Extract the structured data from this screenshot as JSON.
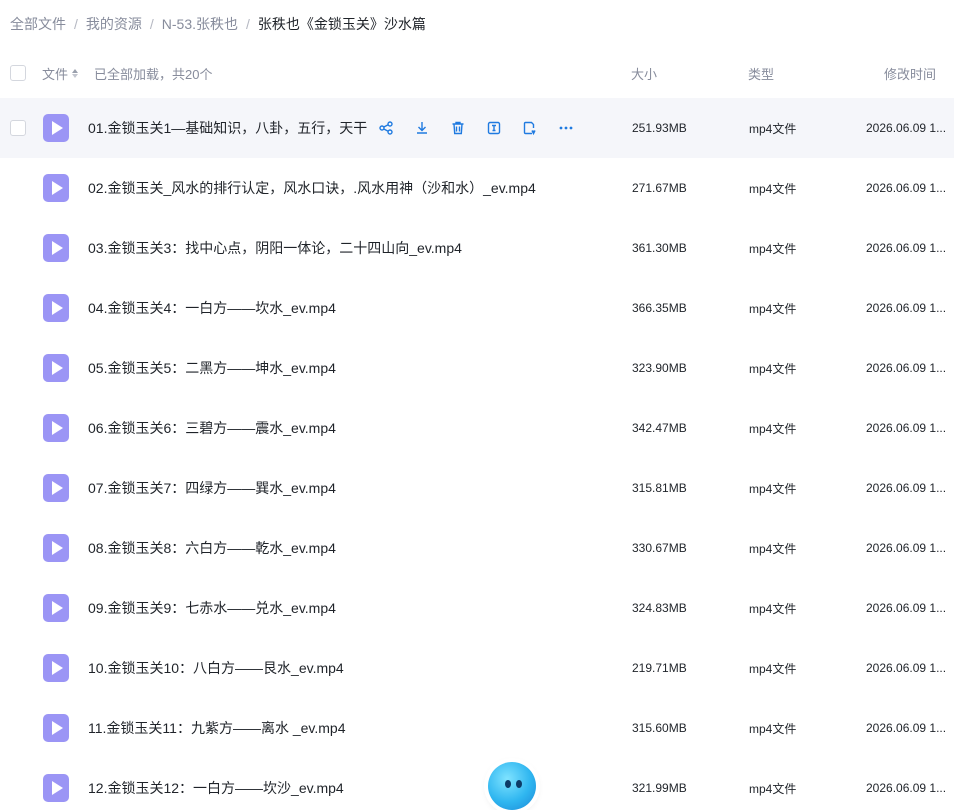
{
  "breadcrumb": [
    "全部文件",
    "我的资源",
    "N-53.张秩也",
    "张秩也《金锁玉关》沙水篇"
  ],
  "header": {
    "name_label": "文件",
    "loaded_text": "已全部加载，共20个",
    "size_label": "大小",
    "type_label": "类型",
    "time_label": "修改时间"
  },
  "files": [
    {
      "name": "01.金锁玉关1—基础知识，八卦，五行，天干",
      "size": "251.93MB",
      "type": "mp4文件",
      "time": "2026.06.09 1..."
    },
    {
      "name": "02.金锁玉关_风水的排行认定，风水口诀，.风水用神（沙和水）_ev.mp4",
      "size": "271.67MB",
      "type": "mp4文件",
      "time": "2026.06.09 1..."
    },
    {
      "name": "03.金锁玉关3：找中心点，阴阳一体论，二十四山向_ev.mp4",
      "size": "361.30MB",
      "type": "mp4文件",
      "time": "2026.06.09 1..."
    },
    {
      "name": "04.金锁玉关4：一白方——坎水_ev.mp4",
      "size": "366.35MB",
      "type": "mp4文件",
      "time": "2026.06.09 1..."
    },
    {
      "name": "05.金锁玉关5：二黑方——坤水_ev.mp4",
      "size": "323.90MB",
      "type": "mp4文件",
      "time": "2026.06.09 1..."
    },
    {
      "name": "06.金锁玉关6：三碧方——震水_ev.mp4",
      "size": "342.47MB",
      "type": "mp4文件",
      "time": "2026.06.09 1..."
    },
    {
      "name": "07.金锁玉关7：四绿方——巽水_ev.mp4",
      "size": "315.81MB",
      "type": "mp4文件",
      "time": "2026.06.09 1..."
    },
    {
      "name": "08.金锁玉关8：六白方——乾水_ev.mp4",
      "size": "330.67MB",
      "type": "mp4文件",
      "time": "2026.06.09 1..."
    },
    {
      "name": "09.金锁玉关9：七赤水——兑水_ev.mp4",
      "size": "324.83MB",
      "type": "mp4文件",
      "time": "2026.06.09 1..."
    },
    {
      "name": "10.金锁玉关10：八白方——艮水_ev.mp4",
      "size": "219.71MB",
      "type": "mp4文件",
      "time": "2026.06.09 1..."
    },
    {
      "name": "11.金锁玉关11：九紫方——离水 _ev.mp4",
      "size": "315.60MB",
      "type": "mp4文件",
      "time": "2026.06.09 1..."
    },
    {
      "name": "12.金锁玉关12：一白方——坎沙_ev.mp4",
      "size": "321.99MB",
      "type": "mp4文件",
      "time": "2026.06.09 1..."
    }
  ],
  "row_actions": [
    "share-icon",
    "download-icon",
    "delete-icon",
    "rename-icon",
    "copy-link-icon",
    "more-icon"
  ],
  "colors": {
    "accent": "#1f7ae0",
    "file_icon": "#9b95f5",
    "hover_row": "#f5f6fa"
  }
}
